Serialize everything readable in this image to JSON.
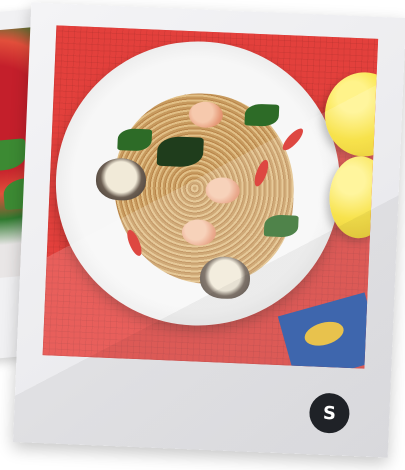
{
  "photos": {
    "back": {
      "name": "tomato-basil-dish-photo"
    },
    "front": {
      "name": "seafood-spaghetti-photo"
    }
  },
  "badge": {
    "letter": "S",
    "icon": "brand-logo-icon",
    "color": "#1f2227"
  },
  "colors": {
    "tablecloth": "#e3403c",
    "plate": "#f7f7f7",
    "lemon": "#f6dd2a",
    "napkin": "#1d4fa8",
    "card": "#f0f0f2"
  }
}
